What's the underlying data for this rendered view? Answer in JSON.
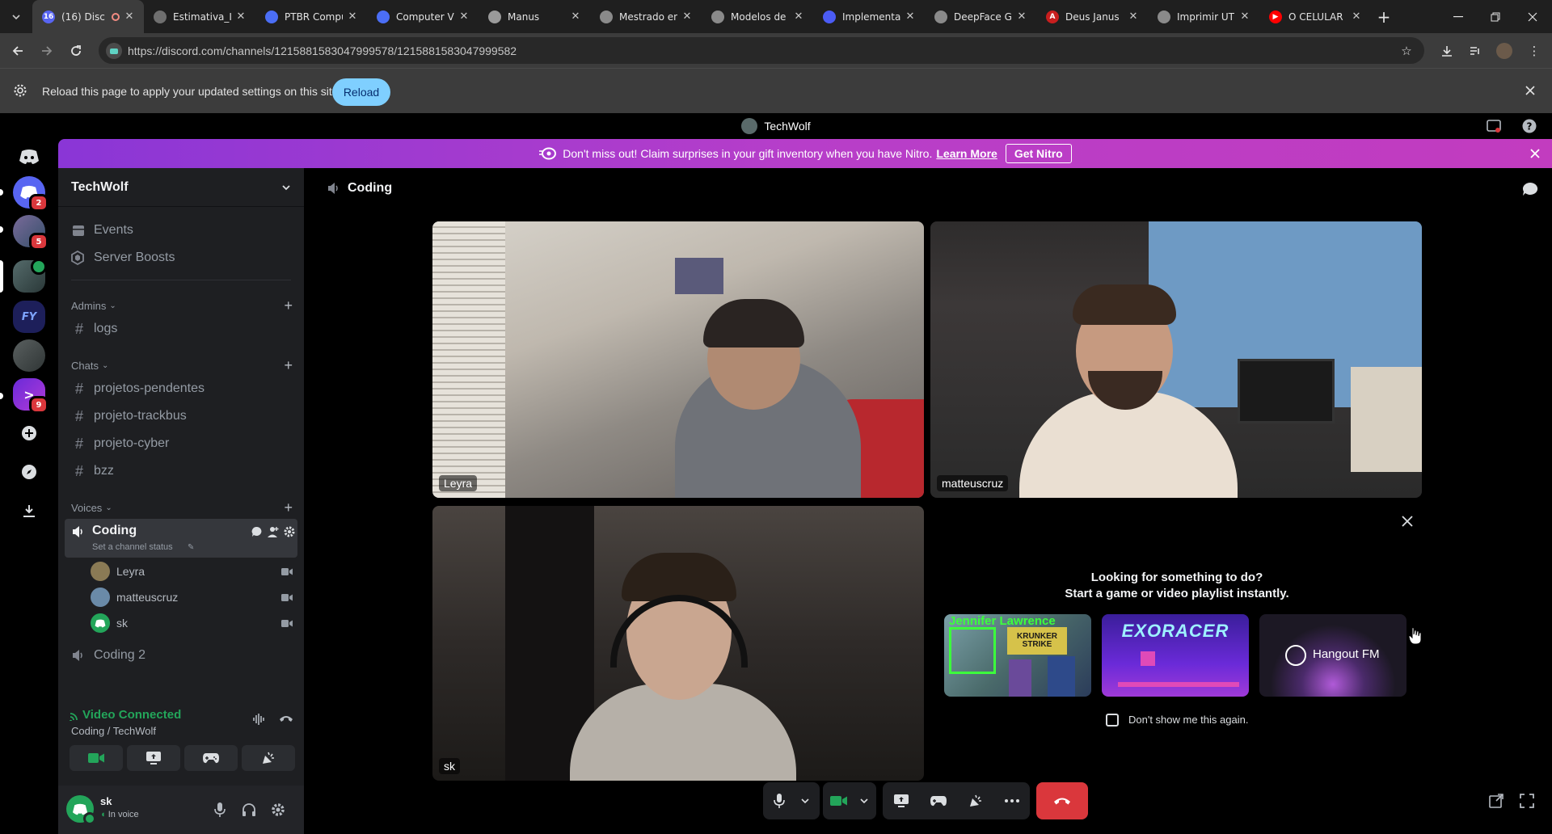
{
  "browser": {
    "tabs": [
      {
        "label": "(16) Disc",
        "fav_color": "#5865f2",
        "fav_text": "16",
        "active": true
      },
      {
        "label": "Estimativa_Ir",
        "fav_color": "#6f6f6f",
        "fav_text": ""
      },
      {
        "label": "PTBR Compu",
        "fav_color": "#4b6ef5",
        "fav_text": ""
      },
      {
        "label": "Computer Vi",
        "fav_color": "#4b6ef5",
        "fav_text": ""
      },
      {
        "label": "Manus",
        "fav_color": "#9a9a9a",
        "fav_text": ""
      },
      {
        "label": "Mestrado en",
        "fav_color": "#8a8a8a",
        "fav_text": ""
      },
      {
        "label": "Modelos de",
        "fav_color": "#8a8a8a",
        "fav_text": ""
      },
      {
        "label": "Implementa",
        "fav_color": "#4b5cf5",
        "fav_text": ""
      },
      {
        "label": "DeepFace GI",
        "fav_color": "#8a8a8a",
        "fav_text": ""
      },
      {
        "label": "Deus Janus",
        "fav_color": "#c81e1e",
        "fav_text": "A"
      },
      {
        "label": "Imprimir UTI",
        "fav_color": "#8a8a8a",
        "fav_text": ""
      },
      {
        "label": "O CELULAR",
        "fav_color": "#ff0000",
        "fav_text": "▶"
      }
    ],
    "url": "https://discord.com/channels/1215881583047999578/1215881583047999582",
    "infobar": {
      "message": "Reload this page to apply your updated settings on this site",
      "button": "Reload"
    }
  },
  "discord": {
    "window_title": "TechWolf",
    "nitro_banner": {
      "text": "Don't miss out! Claim surprises in your gift inventory when you have Nitro.",
      "link": "Learn More",
      "button": "Get Nitro"
    },
    "rail": {
      "badges": [
        "2",
        "5",
        "9"
      ]
    },
    "server_name": "TechWolf",
    "top_items": [
      {
        "label": "Events",
        "icon": "calendar-icon"
      },
      {
        "label": "Server Boosts",
        "icon": "boost-icon"
      }
    ],
    "categories": {
      "admins": "Admins",
      "chats": "Chats",
      "voices": "Voices"
    },
    "admin_channels": [
      "logs"
    ],
    "chat_channels": [
      "projetos-pendentes",
      "projeto-trackbus",
      "projeto-cyber",
      "bzz"
    ],
    "voice_channel": {
      "name": "Coding",
      "status": "Set a channel status",
      "users": [
        {
          "name": "Leyra",
          "color": "#8a7a55"
        },
        {
          "name": "matteuscruz",
          "color": "#6a8aa8"
        },
        {
          "name": "sk",
          "color": "#23a55a"
        }
      ]
    },
    "voice_channel_2": "Coding 2",
    "voice_panel": {
      "status": "Video Connected",
      "location": "Coding / TechWolf"
    },
    "user_panel": {
      "name": "sk",
      "status": "In voice"
    },
    "main": {
      "channel": "Coding",
      "tiles": [
        {
          "name": "Leyra"
        },
        {
          "name": "matteuscruz"
        },
        {
          "name": "sk"
        }
      ],
      "activity": {
        "title": "Looking for something to do?",
        "subtitle": "Start a game or video playlist instantly.",
        "cards": [
          {
            "title": "Jennifer Lawrence",
            "sub": "KRUNKER STRIKE"
          },
          {
            "title": "EXORACER"
          },
          {
            "title": "Hangout FM"
          }
        ],
        "checkbox_label": "Don't show me this again."
      }
    },
    "colors": {
      "blurple": "#5865f2",
      "green": "#23a55a",
      "red": "#da373c"
    }
  }
}
